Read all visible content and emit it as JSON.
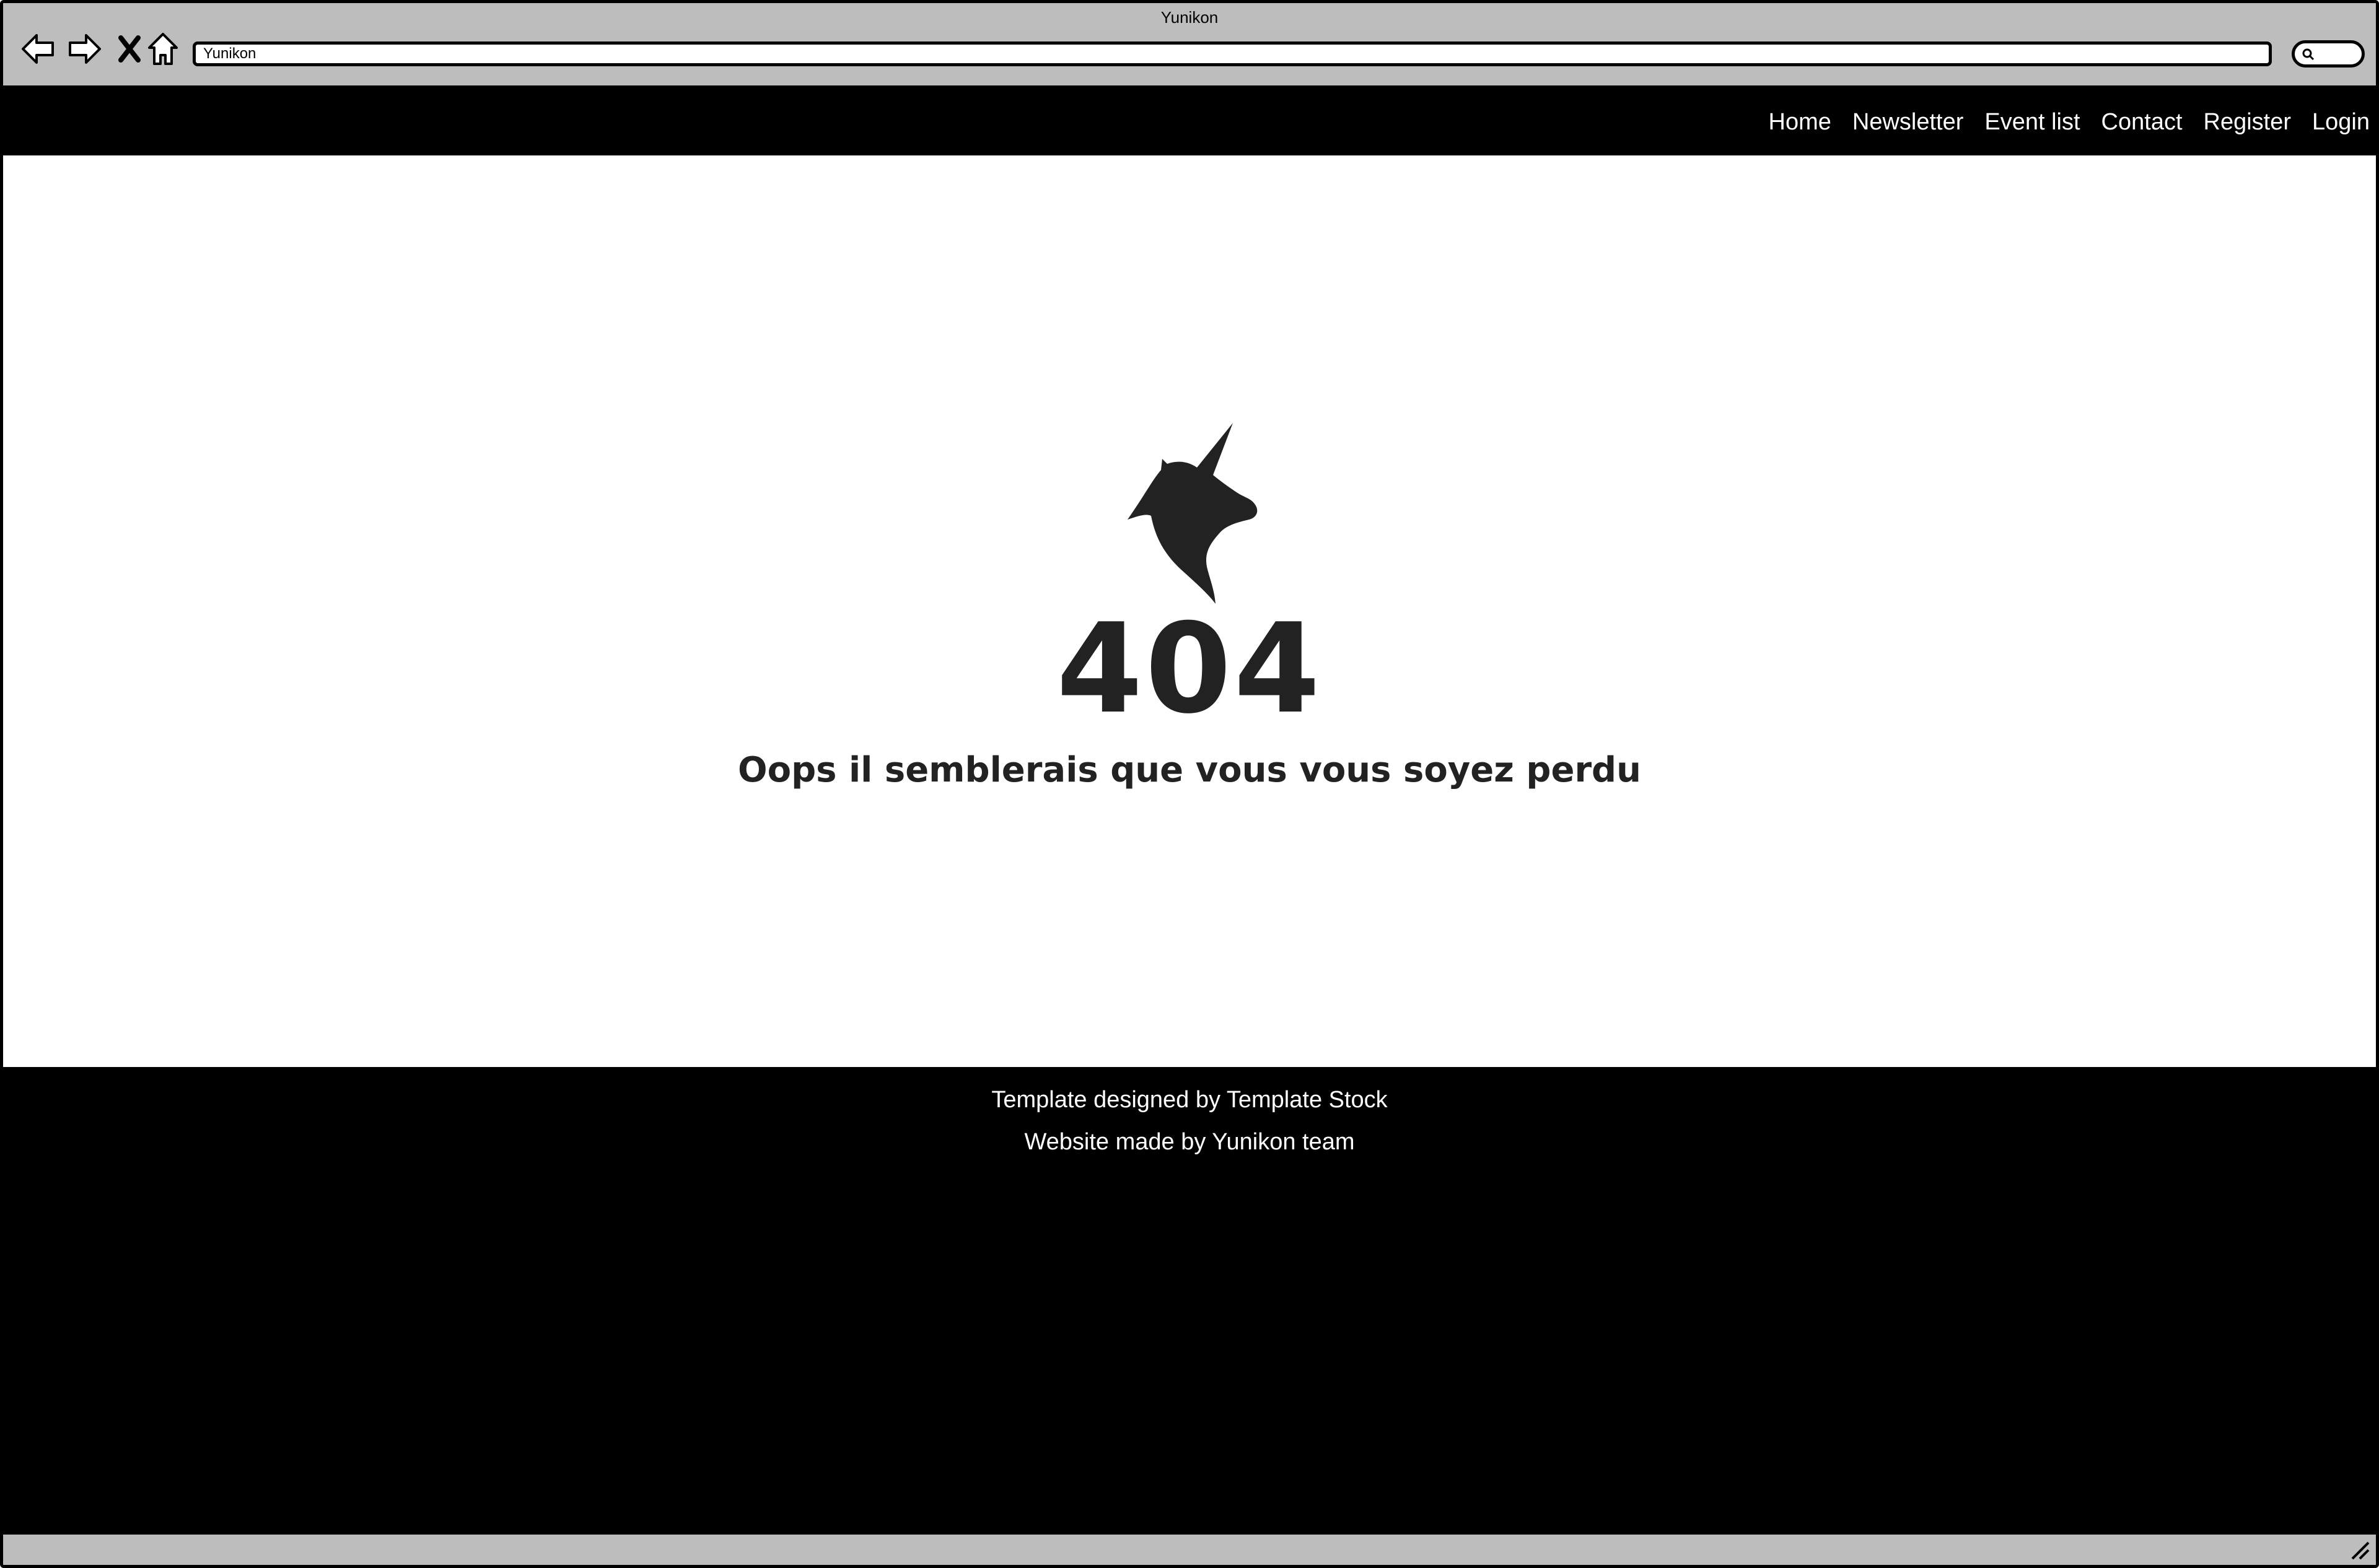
{
  "window": {
    "title": "Yunikon"
  },
  "toolbar": {
    "back_icon": "back-arrow-icon",
    "forward_icon": "forward-arrow-icon",
    "stop_icon": "close-icon",
    "home_icon": "home-icon",
    "address_value": "Yunikon",
    "search_icon": "search-icon"
  },
  "nav": {
    "items": [
      {
        "label": "Home"
      },
      {
        "label": "Newsletter"
      },
      {
        "label": "Event list"
      },
      {
        "label": "Contact"
      },
      {
        "label": "Register"
      },
      {
        "label": "Login"
      }
    ]
  },
  "main": {
    "logo_icon": "unicorn-icon",
    "error_code": "404",
    "message": "Oops il semblerais que vous vous soyez perdu"
  },
  "footer": {
    "line1": "Template designed by Template Stock",
    "line2": "Website made by Yunikon team"
  },
  "colors": {
    "chrome": "#bdbdbd",
    "header_bg": "#000000",
    "footer_bg": "#000000",
    "text_dark": "#222222",
    "text_light": "#ffffff"
  }
}
